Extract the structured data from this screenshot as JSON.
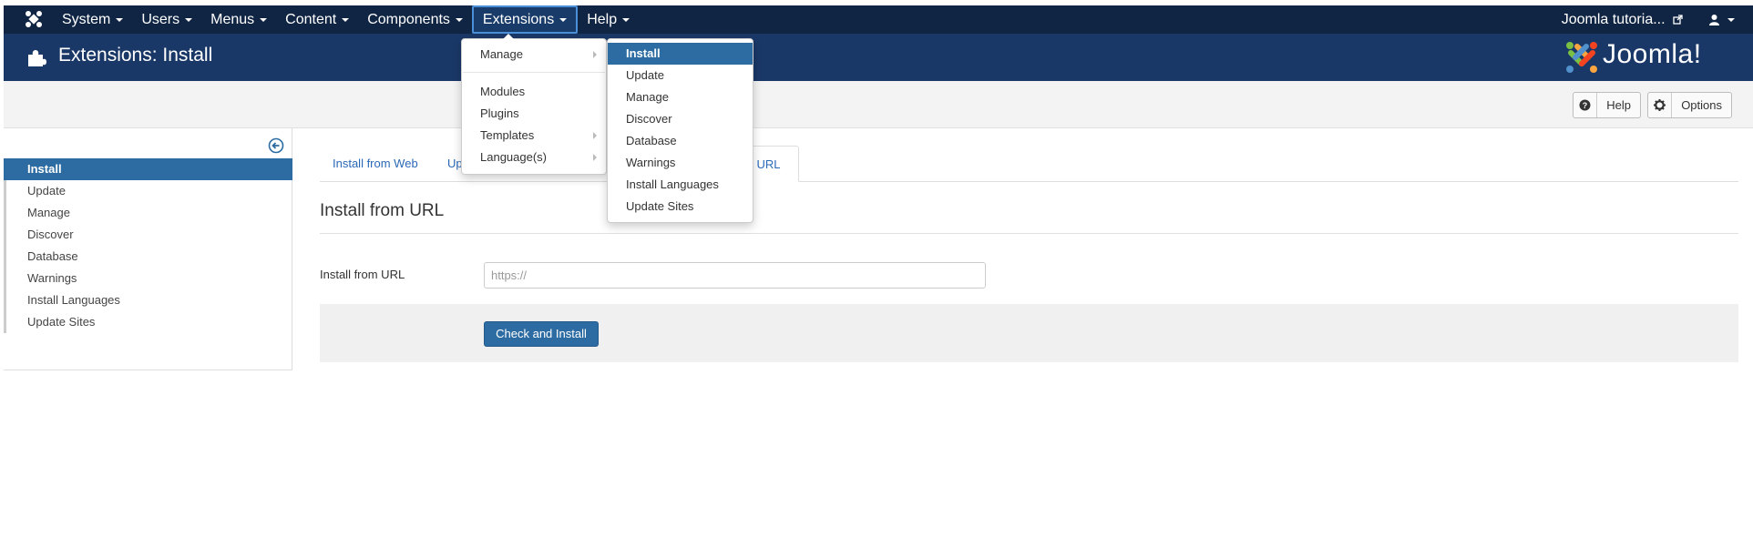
{
  "navbar": {
    "logo_icon": "joomla-icon",
    "items": [
      {
        "label": "System"
      },
      {
        "label": "Users"
      },
      {
        "label": "Menus"
      },
      {
        "label": "Content"
      },
      {
        "label": "Components"
      },
      {
        "label": "Extensions"
      },
      {
        "label": "Help"
      }
    ],
    "site_link": "Joomla tutoria...",
    "external_icon": "external-link-icon",
    "user_icon": "user-icon"
  },
  "header": {
    "title": "Extensions: Install",
    "title_icon": "puzzle-icon",
    "brand": "Joomla!",
    "brand_colors": [
      "#f44321",
      "#5091cd",
      "#f9a541",
      "#7ac143"
    ]
  },
  "toolbar": {
    "help_label": "Help",
    "help_icon": "question-icon",
    "options_label": "Options",
    "options_icon": "gear-icon"
  },
  "sidebar": {
    "toggle_icon": "arrow-left-circle-icon",
    "items": [
      {
        "label": "Install"
      },
      {
        "label": "Update"
      },
      {
        "label": "Manage"
      },
      {
        "label": "Discover"
      },
      {
        "label": "Database"
      },
      {
        "label": "Warnings"
      },
      {
        "label": "Install Languages"
      },
      {
        "label": "Update Sites"
      }
    ]
  },
  "tabs": {
    "web": "Install from Web",
    "upload_partial": "Up",
    "url_partial": "m URL"
  },
  "form": {
    "section_title": "Install from URL",
    "field_label": "Install from URL",
    "url_placeholder": "https://",
    "submit_label": "Check and Install"
  },
  "extensions_menu": {
    "items": [
      {
        "label": "Manage"
      },
      {
        "label": "Modules"
      },
      {
        "label": "Plugins"
      },
      {
        "label": "Templates"
      },
      {
        "label": "Language(s)"
      }
    ]
  },
  "manage_submenu": {
    "items": [
      {
        "label": "Install"
      },
      {
        "label": "Update"
      },
      {
        "label": "Manage"
      },
      {
        "label": "Discover"
      },
      {
        "label": "Database"
      },
      {
        "label": "Warnings"
      },
      {
        "label": "Install Languages"
      },
      {
        "label": "Update Sites"
      }
    ]
  },
  "colors": {
    "navbar_bg": "#102544",
    "header_bg": "#1a3867",
    "accent": "#2d6ca2"
  }
}
